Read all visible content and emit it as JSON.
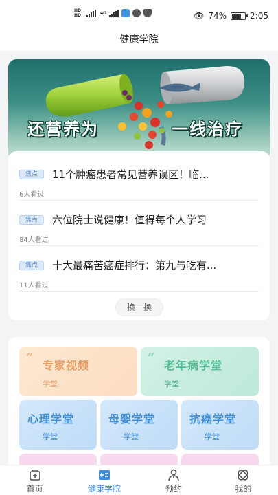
{
  "status_bar": {
    "signal_text_1": "HD",
    "signal_text_2": "4G",
    "battery": "74%",
    "battery_level": 0.74,
    "time": "2:05"
  },
  "header": {
    "title": "健康学院"
  },
  "banner": {
    "text_left": "还营养为",
    "text_right": "一线治疗",
    "colors": {
      "capsule_green": "#9fd13a",
      "capsule_gray": "#c9ccce",
      "background": "#2d7f79"
    }
  },
  "news": {
    "items": [
      {
        "tag": "焦点",
        "title": "11个肿瘤患者常见营养误区！临...",
        "views": "6人看过"
      },
      {
        "tag": "焦点",
        "title": "六位院士说健康！值得每个人学习",
        "views": "84人看过"
      },
      {
        "tag": "焦点",
        "title": "十大最痛苦癌症排行：第九与吃有...",
        "views": "11人看过"
      }
    ],
    "refresh_label": "换一换"
  },
  "categories": {
    "items": [
      {
        "name": "专家视频",
        "sub": "学堂"
      },
      {
        "name": "老年病学堂",
        "sub": "学堂"
      },
      {
        "name": "心理学堂",
        "sub": "学堂"
      },
      {
        "name": "母婴学堂",
        "sub": "学堂"
      },
      {
        "name": "抗癌学堂",
        "sub": "学堂"
      }
    ],
    "quote_mark": "“"
  },
  "bottom_nav": {
    "items": [
      {
        "label": "首页",
        "icon": "home-icon",
        "active": false
      },
      {
        "label": "健康学院",
        "icon": "academy-icon",
        "active": true
      },
      {
        "label": "预约",
        "icon": "doctor-icon",
        "active": false
      },
      {
        "label": "我的",
        "icon": "profile-icon",
        "active": false
      }
    ],
    "active_color": "#3d8de0"
  }
}
